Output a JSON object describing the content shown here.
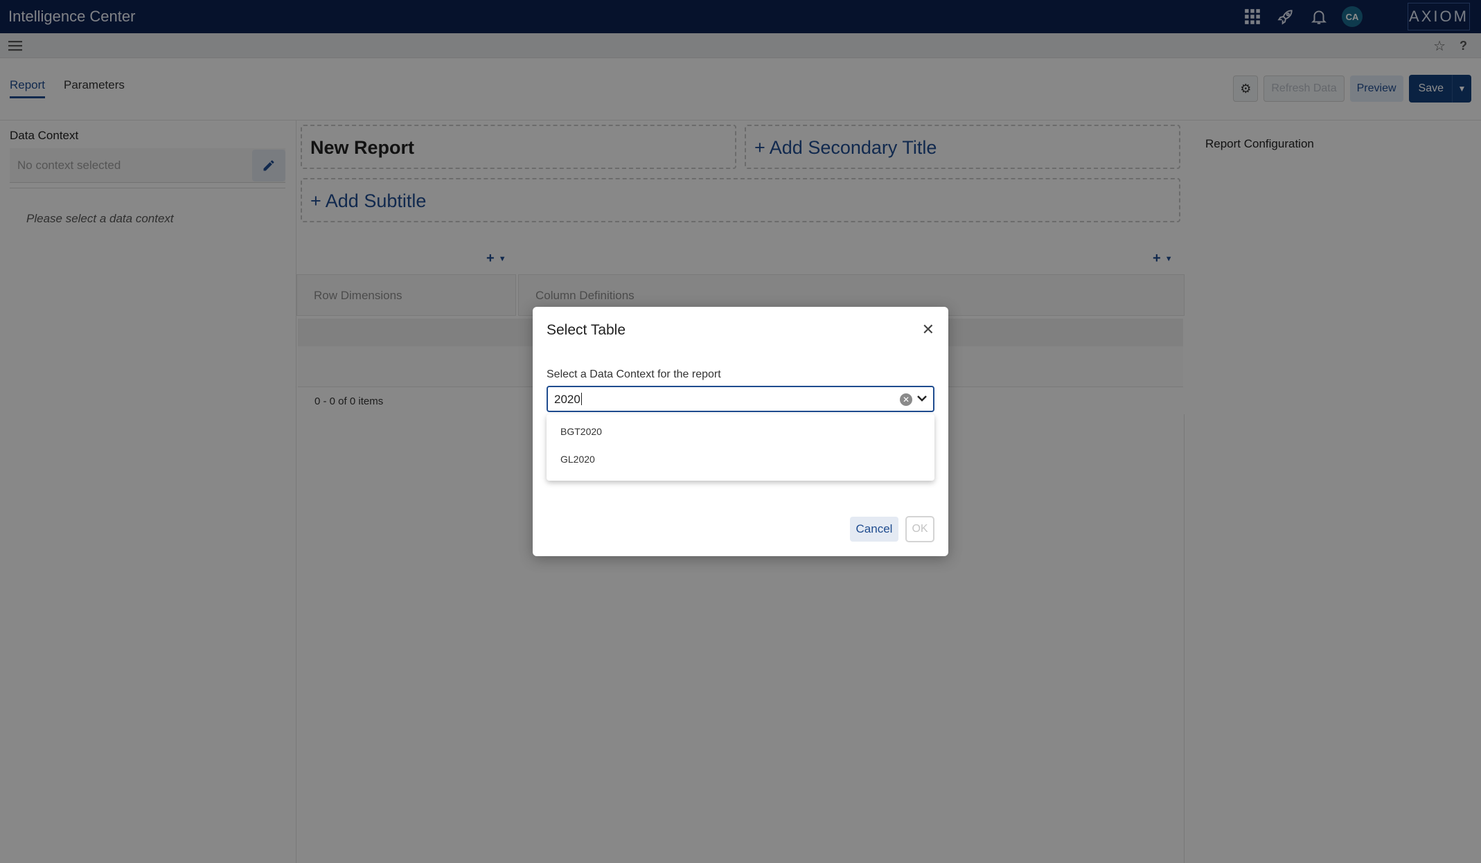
{
  "app": {
    "title": "Intelligence Center",
    "brand": "AXIOM"
  },
  "user": {
    "initials": "CA"
  },
  "tabs": [
    {
      "label": "Report"
    },
    {
      "label": "Parameters"
    }
  ],
  "toolbar": {
    "refresh_label": "Refresh Data",
    "preview_label": "Preview",
    "save_label": "Save"
  },
  "left": {
    "data_context_label": "Data Context",
    "data_context_placeholder": "No context selected",
    "hint": "Please select a data context"
  },
  "center": {
    "title": "New Report",
    "add_secondary_title": "+ Add Secondary Title",
    "add_subtitle": "+ Add Subtitle",
    "row_dimensions_label": "Row Dimensions",
    "column_definitions_label": "Column Definitions",
    "pager_text": "0 - 0 of 0 items"
  },
  "right": {
    "label": "Report Configuration"
  },
  "modal": {
    "title": "Select Table",
    "field_label": "Select a Data Context for the report",
    "input_value": "2020",
    "options": [
      {
        "label": "BGT2020"
      },
      {
        "label": "GL2020"
      }
    ],
    "cancel_label": "Cancel",
    "ok_label": "OK"
  },
  "colors": {
    "topbar": "#0c2150",
    "accent": "#1f4c8f",
    "save": "#133e78"
  }
}
